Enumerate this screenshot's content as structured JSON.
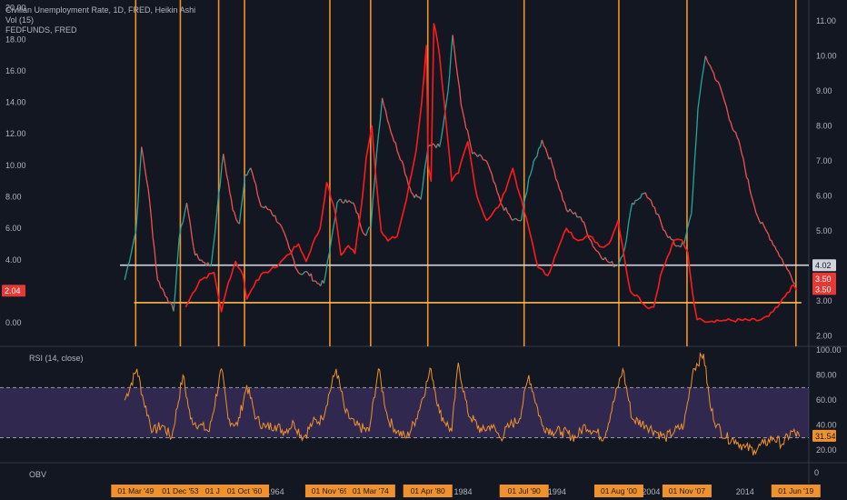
{
  "legend": {
    "main": "Civilian Unemployment Rate, 1D, FRED, Heikin Ashi",
    "vol": "Vol (15)",
    "fed": "FEDFUNDS, FRED",
    "rsi": "RSI (14, close)",
    "obv": "OBV"
  },
  "colors": {
    "background": "#131722",
    "unemployment_up": "#26a69a",
    "unemployment_down": "#ef5350",
    "fedfunds": "#ff1a1a",
    "recession_line": "#f0922c",
    "support_line": "#ffb74d",
    "resistance_line": "#d1d4dc",
    "rsi_line": "#f0922c",
    "rsi_band": "#7e57c2"
  },
  "chart_data": [
    {
      "type": "line",
      "title": "Civilian Unemployment Rate, 1D, FRED, Heikin Ashi",
      "x_axis": {
        "unit": "year",
        "range": [
          1943,
          2025
        ],
        "tick_labels": [
          "1964",
          "1974",
          "1984",
          "1994",
          "2004",
          "2014"
        ]
      },
      "left_axis": {
        "series": "FEDFUNDS",
        "range": [
          -1.5,
          20.5
        ],
        "ticks": [
          "20.00",
          "18.00",
          "16.00",
          "14.00",
          "12.00",
          "10.00",
          "8.00",
          "6.00",
          "4.00",
          "2.00",
          "0.00"
        ]
      },
      "right_axis": {
        "series": "Unemployment",
        "range": [
          1.7,
          11.6
        ],
        "ticks": [
          "11.00",
          "10.00",
          "9.00",
          "8.00",
          "7.00",
          "6.00",
          "5.00",
          "4.00",
          "3.00",
          "2.00"
        ]
      },
      "series": [
        {
          "name": "Civilian Unemployment Rate",
          "axis": "right",
          "x": [
            1948,
            1949.2,
            1949.8,
            1950.5,
            1951.5,
            1952.5,
            1953.2,
            1953.8,
            1954.6,
            1955.5,
            1956.5,
            1957.2,
            1957.8,
            1958.5,
            1959.5,
            1960.2,
            1960.8,
            1961.4,
            1962.5,
            1963.5,
            1964.5,
            1965.5,
            1966.5,
            1967.5,
            1968.5,
            1969.2,
            1969.8,
            1970.6,
            1971.5,
            1972.5,
            1973.5,
            1974.2,
            1974.8,
            1975.4,
            1976.5,
            1977.5,
            1978.5,
            1979.5,
            1980.3,
            1980.8,
            1981.5,
            1982.4,
            1982.9,
            1983.8,
            1985,
            1986.5,
            1988,
            1989.3,
            1990.2,
            1991,
            1992.4,
            1993.5,
            1995,
            1996.5,
            1998,
            1999.5,
            2000.4,
            2001.2,
            2002,
            2003.4,
            2004.2,
            2005.5,
            2006.5,
            2007.5,
            2008.3,
            2009,
            2009.8,
            2010.5,
            2011.5,
            2012.5,
            2013.5,
            2014.5,
            2015.5,
            2016.5,
            2017.5,
            2018.5,
            2019.4
          ],
          "y": [
            3.6,
            5.0,
            7.4,
            6.2,
            3.6,
            3.1,
            2.7,
            4.8,
            5.8,
            4.3,
            4.1,
            4.0,
            5.5,
            7.2,
            5.6,
            5.2,
            6.6,
            6.8,
            5.7,
            5.6,
            5.2,
            4.5,
            3.8,
            3.8,
            3.5,
            3.5,
            4.4,
            5.8,
            5.9,
            5.7,
            4.9,
            5.1,
            7.2,
            8.8,
            7.7,
            7.0,
            6.1,
            5.9,
            7.4,
            7.5,
            7.4,
            9.0,
            10.6,
            8.6,
            7.2,
            7.0,
            5.8,
            5.3,
            5.3,
            6.5,
            7.6,
            6.9,
            5.6,
            5.4,
            4.5,
            4.1,
            4.0,
            4.5,
            5.8,
            6.1,
            5.7,
            5.0,
            4.6,
            4.6,
            5.5,
            8.5,
            10.0,
            9.6,
            9.0,
            8.1,
            7.4,
            6.2,
            5.3,
            4.9,
            4.4,
            3.9,
            3.5
          ]
        },
        {
          "name": "FEDFUNDS",
          "axis": "left",
          "x": [
            1954.5,
            1955,
            1956,
            1957.5,
            1958.3,
            1959,
            1959.8,
            1960.6,
            1961,
            1962,
            1963,
            1964,
            1965,
            1966.5,
            1967.3,
            1968,
            1968.8,
            1969.5,
            1970.4,
            1971,
            1971.8,
            1972.5,
            1973.3,
            1973.7,
            1974.3,
            1974.7,
            1975.3,
            1976,
            1977,
            1978,
            1979,
            1979.6,
            1980.1,
            1980.3,
            1980.6,
            1980.9,
            1981.1,
            1981.5,
            1982,
            1982.8,
            1983.5,
            1984.5,
            1985.5,
            1986.5,
            1987,
            1988,
            1989.3,
            1990,
            1991,
            1992,
            1993,
            1994,
            1995,
            1996,
            1997.5,
            1998.8,
            1999.5,
            2000.5,
            2001.2,
            2001.8,
            2002.5,
            2003.5,
            2004.3,
            2005,
            2006.5,
            2007.3,
            2007.9,
            2008.4,
            2008.9,
            2009.5,
            2012,
            2015.5,
            2016.5,
            2017.5,
            2018.5,
            2019.2,
            2019.5
          ],
          "y": [
            1.0,
            1.6,
            2.7,
            3.2,
            0.7,
            2.5,
            3.9,
            3.0,
            1.5,
            2.7,
            3.2,
            3.5,
            4.1,
            5.0,
            3.9,
            5.0,
            6.0,
            8.9,
            7.0,
            4.3,
            4.9,
            4.4,
            8.0,
            10.5,
            12.5,
            9.5,
            5.8,
            5.2,
            5.5,
            7.9,
            10.9,
            14.0,
            17.6,
            10.0,
            9.0,
            19.0,
            18.5,
            17.0,
            14.0,
            9.0,
            9.5,
            11.5,
            8.0,
            6.5,
            6.8,
            7.6,
            9.8,
            8.2,
            6.0,
            3.5,
            3.0,
            4.5,
            6.0,
            5.3,
            5.5,
            4.8,
            5.0,
            6.5,
            4.0,
            2.0,
            1.75,
            1.0,
            1.0,
            3.0,
            5.25,
            5.25,
            4.5,
            2.0,
            0.2,
            0.15,
            0.15,
            0.15,
            0.4,
            1.0,
            1.9,
            2.4,
            2.04
          ]
        }
      ],
      "vertical_lines": [
        "01 Mar '49",
        "01 Dec '53",
        "01 Jan '",
        "01 Oct '60",
        "01 Nov '69",
        "01 Mar '74",
        "01 Apr '80",
        "01 Jul '90",
        "01 Aug '00",
        "01 Nov '07",
        "01 Jun '19"
      ],
      "vertical_line_years": [
        1949.17,
        1953.92,
        1958.0,
        1960.75,
        1969.83,
        1974.17,
        1980.25,
        1990.5,
        2000.58,
        2007.83,
        2019.42
      ],
      "horizontal_lines": [
        {
          "label": "4.02",
          "axis": "right",
          "value": 4.02,
          "start_year": 1947.5
        },
        {
          "label": "3.50",
          "axis": "right",
          "value": 2.95,
          "start_year": 1949
        }
      ],
      "price_tags": [
        {
          "text": "4.02",
          "axis": "right",
          "value": 4.02
        },
        {
          "text": "3.50",
          "axis": "right",
          "value": 3.64
        },
        {
          "text": "3.50",
          "axis": "right",
          "value": 3.34
        },
        {
          "text": "2.04",
          "axis": "left",
          "value": 2.04
        }
      ]
    },
    {
      "type": "line",
      "title": "RSI (14, close)",
      "y_axis": {
        "range": [
          10,
          103
        ],
        "ticks": [
          "100.00",
          "80.00",
          "60.00",
          "40.00",
          "20.00"
        ]
      },
      "band": [
        30,
        70
      ],
      "last_value": "31.54",
      "series": [
        {
          "name": "RSI",
          "x": [
            1948,
            1949.3,
            1950,
            1951,
            1952,
            1953,
            1954.2,
            1955,
            1956,
            1957,
            1958.3,
            1959,
            1960,
            1961,
            1962,
            1963,
            1964,
            1965,
            1966,
            1967,
            1968,
            1969,
            1970.5,
            1971.5,
            1972.5,
            1974,
            1975,
            1976,
            1977,
            1978,
            1979,
            1980.6,
            1981.5,
            1982.8,
            1983.5,
            1984.5,
            1986,
            1987,
            1988,
            1989,
            1990,
            1991,
            1992.4,
            1993.5,
            1994.5,
            1996,
            1997,
            1998,
            1999,
            2001,
            2002,
            2003.5,
            2004.5,
            2005.5,
            2006.5,
            2007.5,
            2008.5,
            2009.6,
            2010.3,
            2011,
            2012,
            2013,
            2014,
            2015,
            2016,
            2017,
            2018,
            2019,
            2019.8
          ],
          "y": [
            60,
            85,
            60,
            35,
            40,
            30,
            80,
            45,
            40,
            35,
            85,
            45,
            40,
            72,
            45,
            38,
            40,
            35,
            42,
            30,
            42,
            45,
            85,
            50,
            40,
            35,
            85,
            45,
            35,
            30,
            45,
            85,
            50,
            35,
            90,
            50,
            35,
            40,
            30,
            40,
            45,
            80,
            40,
            35,
            35,
            30,
            40,
            35,
            30,
            85,
            45,
            40,
            35,
            30,
            35,
            40,
            85,
            97,
            55,
            40,
            30,
            28,
            22,
            20,
            25,
            30,
            25,
            35,
            31
          ]
        }
      ]
    }
  ],
  "obv_axis_label": "0"
}
